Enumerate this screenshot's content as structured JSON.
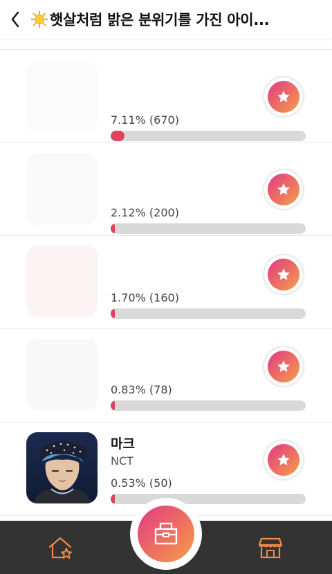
{
  "header": {
    "title": "햇살처럼 밝은 분위기를 가진 아이...",
    "back_icon": "chevron-left-icon",
    "sun_icon": "sun-icon"
  },
  "rows": [
    {
      "name": "",
      "group": "",
      "stat": "7.11% (670)",
      "percent": 7.11,
      "faded": true
    },
    {
      "name": "",
      "group": "",
      "stat": "2.12% (200)",
      "percent": 2.12,
      "faded": true
    },
    {
      "name": "",
      "group": "",
      "stat": "1.70% (160)",
      "percent": 1.7,
      "faded": true
    },
    {
      "name": "",
      "group": "",
      "stat": "0.83% (78)",
      "percent": 0.83,
      "faded": true
    },
    {
      "name": "마크",
      "group": "NCT",
      "stat": "0.53% (50)",
      "percent": 0.53,
      "faded": false
    }
  ],
  "vote_icon": "star-icon",
  "bottom_nav": {
    "left_icon": "home-star-icon",
    "center_icon": "ballot-box-icon",
    "right_icon": "shop-icon"
  },
  "colors": {
    "accent_start": "#e03a86",
    "accent_end": "#f4a04c",
    "bar_fill": "#e0415f",
    "bar_track": "#d9d9d9",
    "bottom_bar": "#333333",
    "nav_icon": "#f08a4b"
  }
}
